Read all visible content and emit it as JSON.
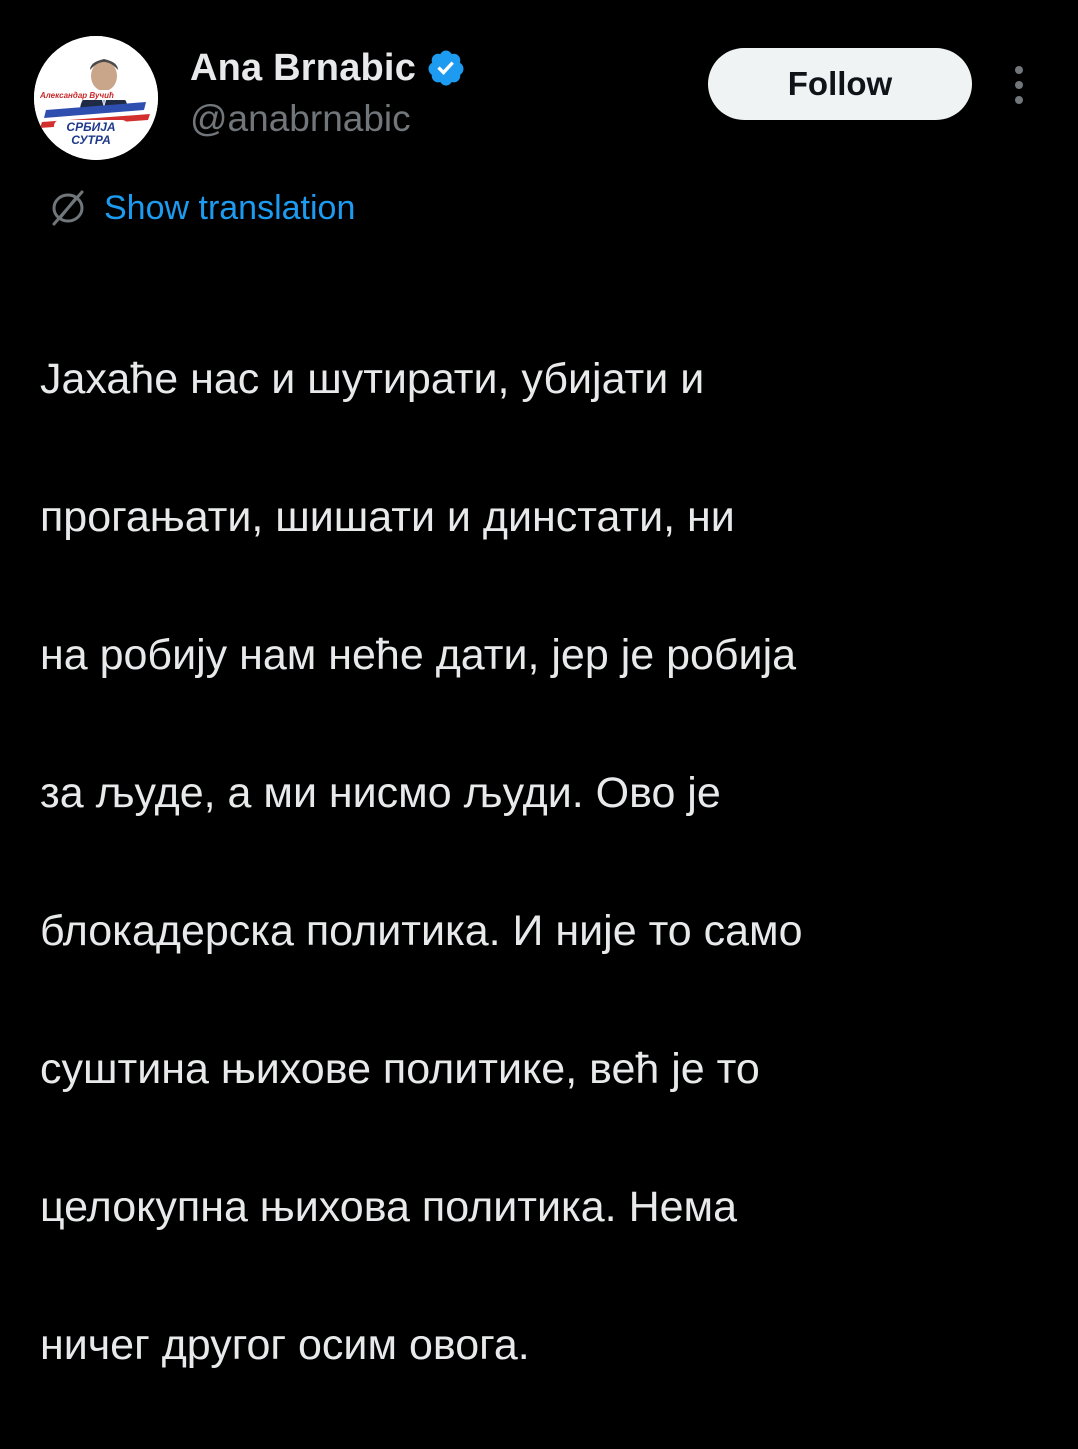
{
  "author": {
    "name": "Ana Brnabic",
    "handle": "@anabrnabic",
    "verified": true,
    "avatar": {
      "icon": "campaign-logo-avatar",
      "caption": "Александар Вучић",
      "line1": "СРБИЈА",
      "line2": "СУТРА"
    }
  },
  "follow_button": {
    "label": "Follow"
  },
  "more_menu": {
    "icon": "more-vertical-icon"
  },
  "translation": {
    "icon": "translate-globe-icon",
    "label": "Show translation"
  },
  "tweet": {
    "lines": [
      "Јахаће нас и шутирати, убијати и",
      "прогањати, шишати и динстати, ни",
      "на робију нам неће дати, јер је робија",
      "за људе, а ми нисмо људи. Ово је",
      "блокадерска политика. И није то само",
      "суштина њихове политике, већ је то",
      "целокупна њихова политика. Нема",
      "ничег другог осим овога."
    ]
  },
  "colors": {
    "background": "#000000",
    "text": "#e7e9ea",
    "secondary_text": "#71767b",
    "link": "#1d9bf0",
    "verified_badge": "#1d9bf0",
    "follow_button_bg": "#eff3f4",
    "follow_button_text": "#0f1419"
  }
}
